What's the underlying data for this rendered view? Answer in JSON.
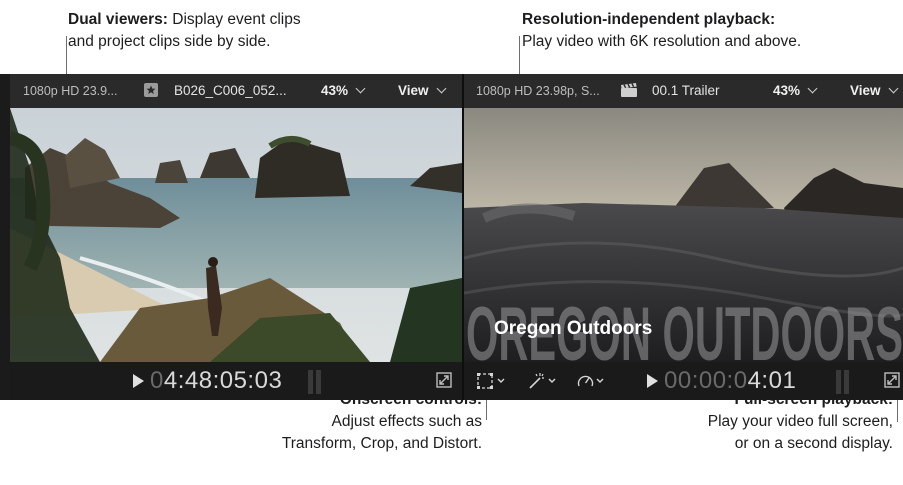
{
  "callouts": {
    "dual_viewers": {
      "title": "Dual viewers:",
      "line1": "Display event clips",
      "line2": "and project clips side by side."
    },
    "resolution": {
      "title": "Resolution-independent playback:",
      "line2": "Play video with 6K resolution and above."
    },
    "onscreen": {
      "title": "Onscreen controls:",
      "line2": "Adjust effects such as",
      "line3": "Transform, Crop, and Distort."
    },
    "fullscreen": {
      "title": "Full-screen playback:",
      "line2": "Play your video full screen,",
      "line3": "or on a second display."
    }
  },
  "event_viewer": {
    "format": "1080p HD 23.9...",
    "clip_name": "B026_C006_052...",
    "zoom": "43%",
    "view_label": "View",
    "timecode_dim": "0",
    "timecode": "4:48:05:03",
    "icons": [
      "clip-icon",
      "play-icon",
      "fullscreen-icon"
    ]
  },
  "project_viewer": {
    "format": "1080p HD 23.98p, S...",
    "project_name": "00.1 Trailer",
    "zoom": "43%",
    "view_label": "View",
    "timecode_dim": "00:00:0",
    "timecode": "4:01",
    "overlay_title_large": "OREGON OUTDOORS",
    "overlay_title_small": "Oregon Outdoors",
    "icons": [
      "clapper-icon",
      "transform-icon",
      "magic-wand-icon",
      "speed-icon",
      "play-icon",
      "fullscreen-icon"
    ]
  },
  "colors": {
    "background": "#1b1b1b",
    "header": "#2a2a2a",
    "text": "#e4e4e4"
  }
}
